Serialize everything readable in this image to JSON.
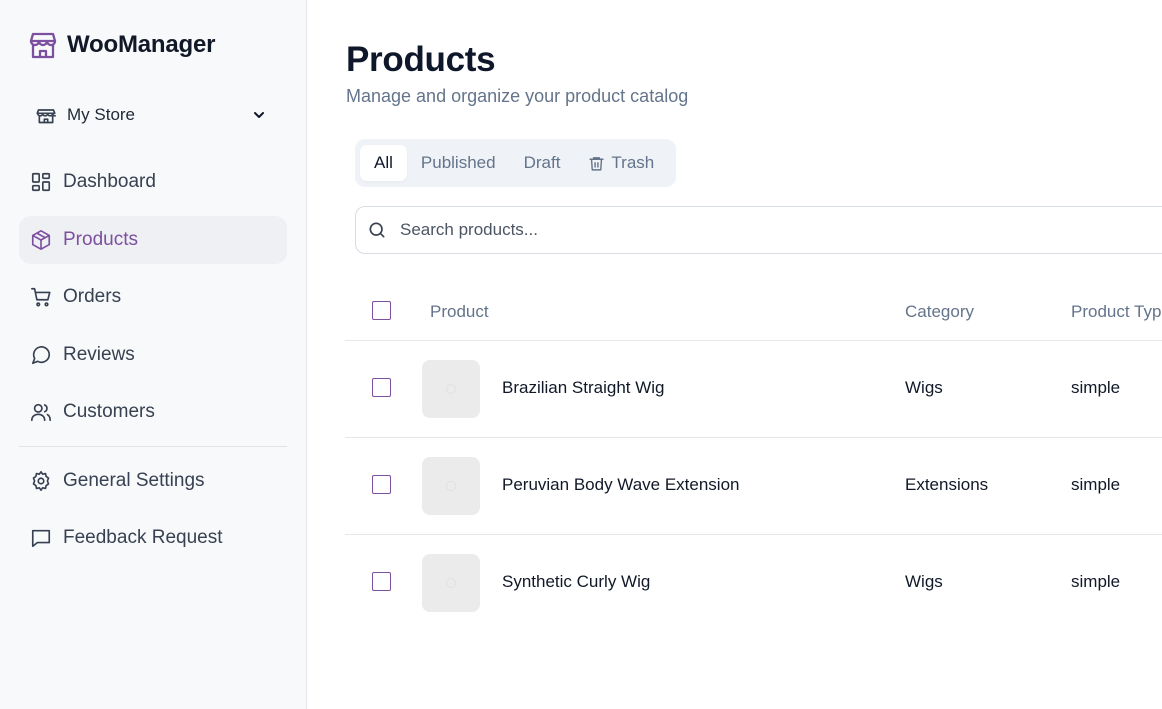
{
  "app": {
    "name": "WooManager"
  },
  "store": {
    "selected": "My Store"
  },
  "sidebar": {
    "items": [
      {
        "label": "Dashboard",
        "icon": "dashboard-icon"
      },
      {
        "label": "Products",
        "icon": "box-icon",
        "active": true
      },
      {
        "label": "Orders",
        "icon": "cart-icon"
      },
      {
        "label": "Reviews",
        "icon": "chat-bubble-icon"
      },
      {
        "label": "Customers",
        "icon": "users-icon"
      }
    ],
    "secondary": [
      {
        "label": "General Settings",
        "icon": "gear-icon"
      },
      {
        "label": "Feedback Request",
        "icon": "message-square-icon"
      }
    ]
  },
  "page": {
    "title": "Products",
    "subtitle": "Manage and organize your product catalog"
  },
  "tabs": [
    {
      "label": "All",
      "active": true
    },
    {
      "label": "Published"
    },
    {
      "label": "Draft"
    },
    {
      "label": "Trash",
      "icon": "trash-icon"
    }
  ],
  "search": {
    "placeholder": "Search products..."
  },
  "table": {
    "columns": [
      "Product",
      "Category",
      "Product Type"
    ],
    "rows": [
      {
        "name": "Brazilian Straight Wig",
        "category": "Wigs",
        "type": "simple"
      },
      {
        "name": "Peruvian Body Wave Extension",
        "category": "Extensions",
        "type": "simple"
      },
      {
        "name": "Synthetic Curly Wig",
        "category": "Wigs",
        "type": "simple"
      }
    ]
  },
  "colors": {
    "brand": "#7c4f9f",
    "sidebar_bg": "#f8f9fb",
    "active_bg": "#eff0f3",
    "muted_text": "#64748b"
  }
}
